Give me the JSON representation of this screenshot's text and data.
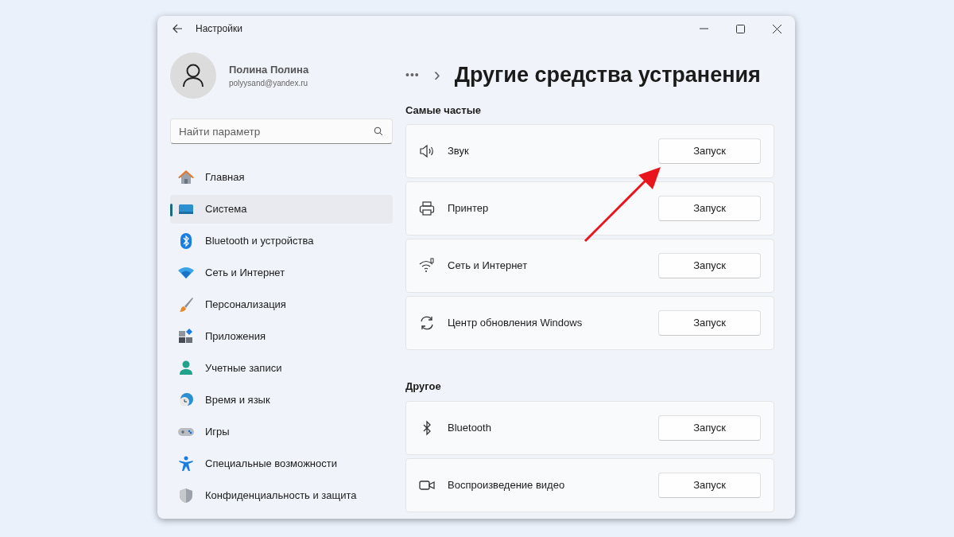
{
  "window": {
    "title": "Настройки"
  },
  "user": {
    "name": "Полина Полина",
    "email": "polyysand@yandex.ru"
  },
  "search": {
    "placeholder": "Найти параметр"
  },
  "sidebar": {
    "items": [
      {
        "label": "Главная",
        "selected": false
      },
      {
        "label": "Система",
        "selected": true
      },
      {
        "label": "Bluetooth и устройства",
        "selected": false
      },
      {
        "label": "Сеть и Интернет",
        "selected": false
      },
      {
        "label": "Персонализация",
        "selected": false
      },
      {
        "label": "Приложения",
        "selected": false
      },
      {
        "label": "Учетные записи",
        "selected": false
      },
      {
        "label": "Время и язык",
        "selected": false
      },
      {
        "label": "Игры",
        "selected": false
      },
      {
        "label": "Специальные возможности",
        "selected": false
      },
      {
        "label": "Конфиденциальность и защита",
        "selected": false
      }
    ]
  },
  "breadcrumb": {
    "more": "•••",
    "separator": "›",
    "title": "Другие средства устранения"
  },
  "sections": [
    {
      "heading": "Самые частые",
      "items": [
        {
          "label": "Звук",
          "button": "Запуск"
        },
        {
          "label": "Принтер",
          "button": "Запуск"
        },
        {
          "label": "Сеть и Интернет",
          "button": "Запуск"
        },
        {
          "label": "Центр обновления Windows",
          "button": "Запуск"
        }
      ]
    },
    {
      "heading": "Другое",
      "items": [
        {
          "label": "Bluetooth",
          "button": "Запуск"
        },
        {
          "label": "Воспроизведение видео",
          "button": "Запуск"
        }
      ]
    }
  ]
}
